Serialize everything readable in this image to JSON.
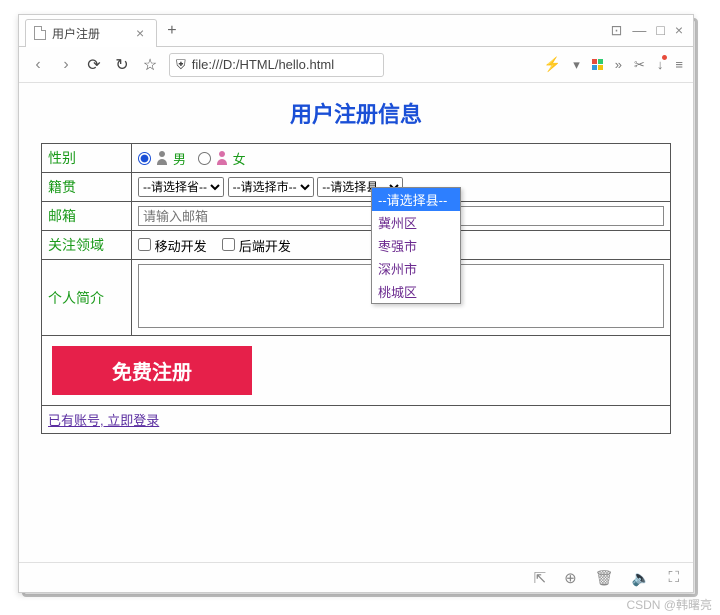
{
  "window": {
    "tab_title": "用户注册",
    "new_tab": "+",
    "win_buttons": {
      "pin": "⊡",
      "min": "—",
      "max": "□",
      "close": "×"
    }
  },
  "urlbar": {
    "back": "‹",
    "forward": "›",
    "reload": "⟳",
    "reload2": "↻",
    "star": "☆",
    "shield": "⛨",
    "url": "file:///D:/HTML/hello.html",
    "lightning": "⚡",
    "dropdown": "▾",
    "more": "»",
    "scissors": "✂",
    "down": "↓",
    "menu": "≡"
  },
  "page": {
    "title": "用户注册信息",
    "labels": {
      "gender": "性别",
      "native": "籍贯",
      "email": "邮箱",
      "interest": "关注领域",
      "intro": "个人简介"
    },
    "gender": {
      "male": "男",
      "female": "女"
    },
    "native_selects": {
      "province": "--请选择省--",
      "city": "--请选择市--",
      "county": "--请选择县--"
    },
    "county_options": [
      "--请选择县--",
      "冀州区",
      "枣强市",
      "深州市",
      "桃城区"
    ],
    "email_placeholder": "请输入邮箱",
    "interests": {
      "mobile": "移动开发",
      "backend": "后端开发"
    },
    "submit": "免费注册",
    "login_link": "已有账号, 立即登录"
  },
  "bottombar": {
    "i1": "⇱",
    "i2": "⊕",
    "i3": "🗑",
    "i4": "🔈",
    "i5": "⛶"
  },
  "watermark": "CSDN @韩曙亮"
}
